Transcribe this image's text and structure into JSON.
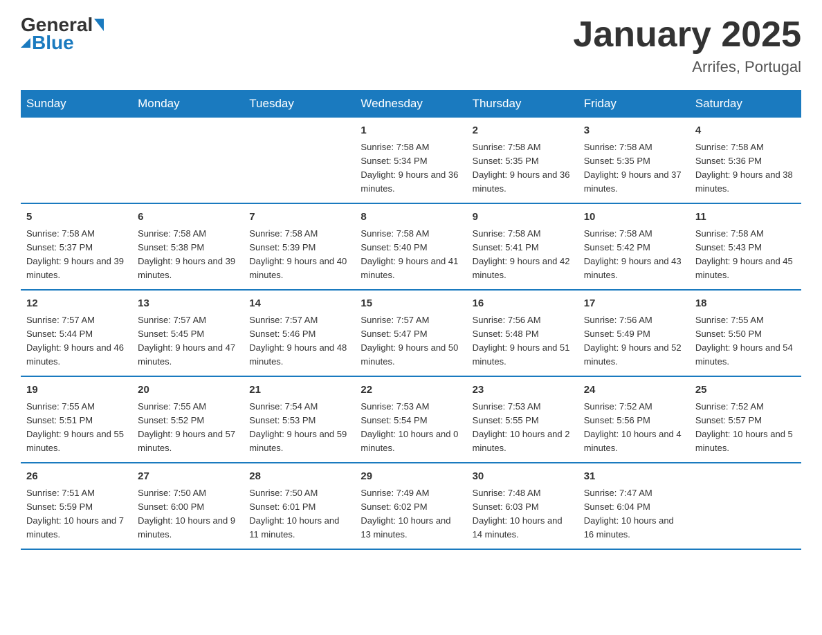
{
  "header": {
    "logo": {
      "general": "General",
      "blue": "Blue"
    },
    "title": "January 2025",
    "subtitle": "Arrifes, Portugal"
  },
  "weekdays": [
    "Sunday",
    "Monday",
    "Tuesday",
    "Wednesday",
    "Thursday",
    "Friday",
    "Saturday"
  ],
  "weeks": [
    [
      {
        "day": "",
        "info": ""
      },
      {
        "day": "",
        "info": ""
      },
      {
        "day": "",
        "info": ""
      },
      {
        "day": "1",
        "info": "Sunrise: 7:58 AM\nSunset: 5:34 PM\nDaylight: 9 hours and 36 minutes."
      },
      {
        "day": "2",
        "info": "Sunrise: 7:58 AM\nSunset: 5:35 PM\nDaylight: 9 hours and 36 minutes."
      },
      {
        "day": "3",
        "info": "Sunrise: 7:58 AM\nSunset: 5:35 PM\nDaylight: 9 hours and 37 minutes."
      },
      {
        "day": "4",
        "info": "Sunrise: 7:58 AM\nSunset: 5:36 PM\nDaylight: 9 hours and 38 minutes."
      }
    ],
    [
      {
        "day": "5",
        "info": "Sunrise: 7:58 AM\nSunset: 5:37 PM\nDaylight: 9 hours and 39 minutes."
      },
      {
        "day": "6",
        "info": "Sunrise: 7:58 AM\nSunset: 5:38 PM\nDaylight: 9 hours and 39 minutes."
      },
      {
        "day": "7",
        "info": "Sunrise: 7:58 AM\nSunset: 5:39 PM\nDaylight: 9 hours and 40 minutes."
      },
      {
        "day": "8",
        "info": "Sunrise: 7:58 AM\nSunset: 5:40 PM\nDaylight: 9 hours and 41 minutes."
      },
      {
        "day": "9",
        "info": "Sunrise: 7:58 AM\nSunset: 5:41 PM\nDaylight: 9 hours and 42 minutes."
      },
      {
        "day": "10",
        "info": "Sunrise: 7:58 AM\nSunset: 5:42 PM\nDaylight: 9 hours and 43 minutes."
      },
      {
        "day": "11",
        "info": "Sunrise: 7:58 AM\nSunset: 5:43 PM\nDaylight: 9 hours and 45 minutes."
      }
    ],
    [
      {
        "day": "12",
        "info": "Sunrise: 7:57 AM\nSunset: 5:44 PM\nDaylight: 9 hours and 46 minutes."
      },
      {
        "day": "13",
        "info": "Sunrise: 7:57 AM\nSunset: 5:45 PM\nDaylight: 9 hours and 47 minutes."
      },
      {
        "day": "14",
        "info": "Sunrise: 7:57 AM\nSunset: 5:46 PM\nDaylight: 9 hours and 48 minutes."
      },
      {
        "day": "15",
        "info": "Sunrise: 7:57 AM\nSunset: 5:47 PM\nDaylight: 9 hours and 50 minutes."
      },
      {
        "day": "16",
        "info": "Sunrise: 7:56 AM\nSunset: 5:48 PM\nDaylight: 9 hours and 51 minutes."
      },
      {
        "day": "17",
        "info": "Sunrise: 7:56 AM\nSunset: 5:49 PM\nDaylight: 9 hours and 52 minutes."
      },
      {
        "day": "18",
        "info": "Sunrise: 7:55 AM\nSunset: 5:50 PM\nDaylight: 9 hours and 54 minutes."
      }
    ],
    [
      {
        "day": "19",
        "info": "Sunrise: 7:55 AM\nSunset: 5:51 PM\nDaylight: 9 hours and 55 minutes."
      },
      {
        "day": "20",
        "info": "Sunrise: 7:55 AM\nSunset: 5:52 PM\nDaylight: 9 hours and 57 minutes."
      },
      {
        "day": "21",
        "info": "Sunrise: 7:54 AM\nSunset: 5:53 PM\nDaylight: 9 hours and 59 minutes."
      },
      {
        "day": "22",
        "info": "Sunrise: 7:53 AM\nSunset: 5:54 PM\nDaylight: 10 hours and 0 minutes."
      },
      {
        "day": "23",
        "info": "Sunrise: 7:53 AM\nSunset: 5:55 PM\nDaylight: 10 hours and 2 minutes."
      },
      {
        "day": "24",
        "info": "Sunrise: 7:52 AM\nSunset: 5:56 PM\nDaylight: 10 hours and 4 minutes."
      },
      {
        "day": "25",
        "info": "Sunrise: 7:52 AM\nSunset: 5:57 PM\nDaylight: 10 hours and 5 minutes."
      }
    ],
    [
      {
        "day": "26",
        "info": "Sunrise: 7:51 AM\nSunset: 5:59 PM\nDaylight: 10 hours and 7 minutes."
      },
      {
        "day": "27",
        "info": "Sunrise: 7:50 AM\nSunset: 6:00 PM\nDaylight: 10 hours and 9 minutes."
      },
      {
        "day": "28",
        "info": "Sunrise: 7:50 AM\nSunset: 6:01 PM\nDaylight: 10 hours and 11 minutes."
      },
      {
        "day": "29",
        "info": "Sunrise: 7:49 AM\nSunset: 6:02 PM\nDaylight: 10 hours and 13 minutes."
      },
      {
        "day": "30",
        "info": "Sunrise: 7:48 AM\nSunset: 6:03 PM\nDaylight: 10 hours and 14 minutes."
      },
      {
        "day": "31",
        "info": "Sunrise: 7:47 AM\nSunset: 6:04 PM\nDaylight: 10 hours and 16 minutes."
      },
      {
        "day": "",
        "info": ""
      }
    ]
  ]
}
